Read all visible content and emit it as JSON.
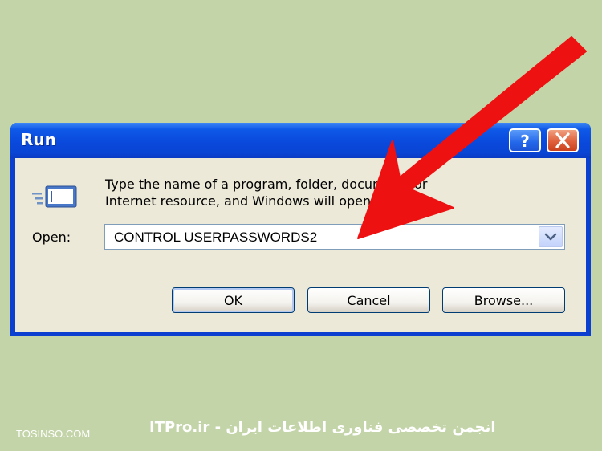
{
  "window": {
    "title": "Run",
    "titlebar_icons": [
      "help-icon",
      "close-icon"
    ]
  },
  "dialog": {
    "description_line1": "Type the name of a program, folder, document, or",
    "description_line2": "Internet resource, and Windows will open it for you.",
    "open_label": "Open:",
    "open_value": "CONTROL USERPASSWORDS2",
    "icon": "run-icon"
  },
  "buttons": {
    "ok": "OK",
    "cancel": "Cancel",
    "browse": "Browse..."
  },
  "annotation": {
    "arrow_color": "#ee1111"
  },
  "watermark": {
    "left": "TOSINSO.COM",
    "center": "ITPro.ir - انجمن تخصصی فناوری اطلاعات ایران"
  },
  "colors": {
    "background": "#c3d4a8",
    "titlebar": "#0a49dc",
    "client": "#ece9d8"
  }
}
